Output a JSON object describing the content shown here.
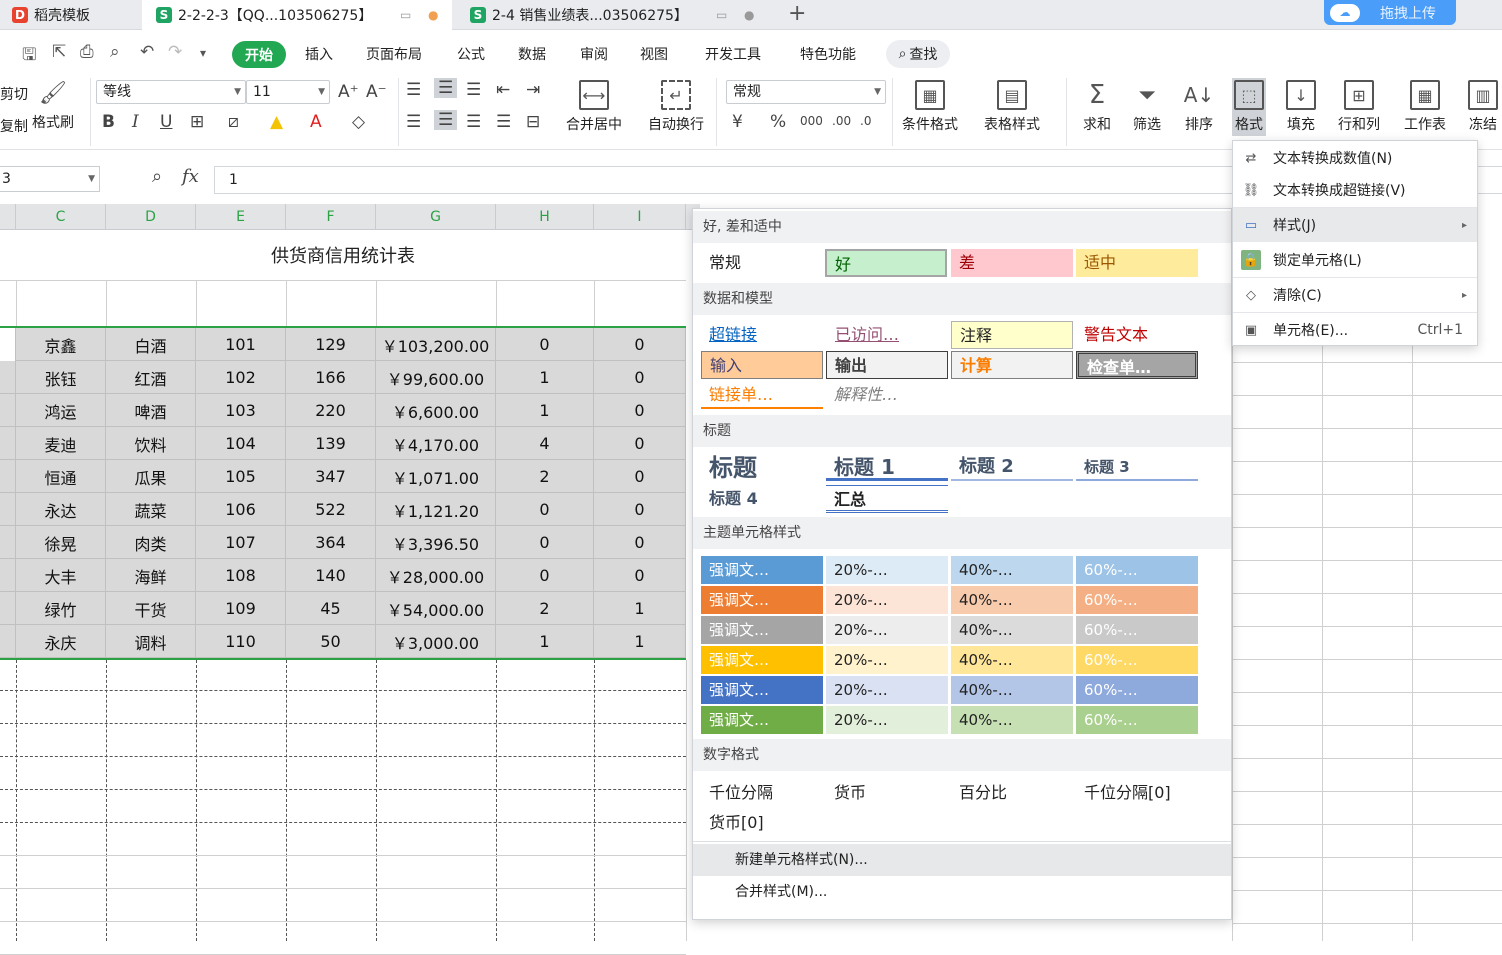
{
  "tabs": [
    {
      "label": "稻壳模板",
      "logo": "D"
    },
    {
      "label": "2-2-2-3【QQ...103506275】",
      "logo": "S"
    },
    {
      "label": "2-4 销售业绩表...03506275】",
      "logo": "S"
    }
  ],
  "upload_label": "拖拽上传",
  "menu": {
    "home": "开始",
    "items": [
      "插入",
      "页面布局",
      "公式",
      "数据",
      "审阅",
      "视图",
      "开发工具",
      "特色功能"
    ],
    "search": "查找"
  },
  "ribbon": {
    "cut": "剪切",
    "copy": "复制",
    "format_painter": "格式刷",
    "font_name": "等线",
    "font_size": "11",
    "number_format": "常规",
    "merge": "合并居中",
    "wrap": "自动换行",
    "cond_format": "条件格式",
    "table_style": "表格样式",
    "sum": "求和",
    "filter": "筛选",
    "sort": "排序",
    "format": "格式",
    "fill": "填充",
    "rowcol": "行和列",
    "sheet": "工作表",
    "freeze": "冻结"
  },
  "formula_bar": {
    "name_box": "3",
    "fx": "fx",
    "value": "1"
  },
  "columns": [
    "C",
    "D",
    "E",
    "F",
    "G",
    "H",
    "I"
  ],
  "sheet_title": "供货商信用统计表",
  "rows": [
    [
      "京鑫",
      "白酒",
      "101",
      "129",
      "￥103,200.00",
      "0",
      "0"
    ],
    [
      "张钰",
      "红酒",
      "102",
      "166",
      "￥99,600.00",
      "1",
      "0"
    ],
    [
      "鸿运",
      "啤酒",
      "103",
      "220",
      "￥6,600.00",
      "1",
      "0"
    ],
    [
      "麦迪",
      "饮料",
      "104",
      "139",
      "￥4,170.00",
      "4",
      "0"
    ],
    [
      "恒通",
      "瓜果",
      "105",
      "347",
      "￥1,071.00",
      "2",
      "0"
    ],
    [
      "永达",
      "蔬菜",
      "106",
      "522",
      "￥1,121.20",
      "0",
      "0"
    ],
    [
      "徐晃",
      "肉类",
      "107",
      "364",
      "￥3,396.50",
      "0",
      "0"
    ],
    [
      "大丰",
      "海鲜",
      "108",
      "140",
      "￥28,000.00",
      "0",
      "0"
    ],
    [
      "绿竹",
      "干货",
      "109",
      "45",
      "￥54,000.00",
      "2",
      "1"
    ],
    [
      "永庆",
      "调料",
      "110",
      "50",
      "￥3,000.00",
      "1",
      "1"
    ]
  ],
  "styles_panel": {
    "sec_good": "好, 差和适中",
    "good_items": [
      "常规",
      "好",
      "差",
      "适中"
    ],
    "sec_data": "数据和模型",
    "data_items": [
      "超链接",
      "已访问…",
      "注释",
      "警告文本",
      "输入",
      "输出",
      "计算",
      "检查单…",
      "链接单…",
      "解释性…"
    ],
    "sec_title": "标题",
    "title_items": [
      "标题",
      "标题 1",
      "标题 2",
      "标题 3",
      "标题 4",
      "汇总"
    ],
    "sec_theme": "主题单元格样式",
    "theme_labels": [
      "强调文…",
      "20%-…",
      "40%-…",
      "60%-…"
    ],
    "theme_colors": [
      [
        "#5b9bd5",
        "#ddebf7",
        "#bdd7ee",
        "#9dc3e6"
      ],
      [
        "#ed7d31",
        "#fce4d6",
        "#f8cbad",
        "#f4b084"
      ],
      [
        "#a5a5a5",
        "#ededed",
        "#dbdbdb",
        "#c9c9c9"
      ],
      [
        "#ffc000",
        "#fff2cc",
        "#ffe699",
        "#ffd966"
      ],
      [
        "#4472c4",
        "#d9e1f2",
        "#b4c6e7",
        "#8ea9db"
      ],
      [
        "#70ad47",
        "#e2efda",
        "#c6e0b4",
        "#a9d08e"
      ]
    ],
    "sec_number": "数字格式",
    "number_items": [
      "千位分隔",
      "货币",
      "百分比",
      "千位分隔[0]",
      "货币[0]"
    ],
    "new_style": "新建单元格样式(N)...",
    "merge_style": "合并样式(M)..."
  },
  "context_menu": [
    {
      "label": "文本转换成数值(N)",
      "icon": "text-to-number-icon"
    },
    {
      "label": "文本转换成超链接(V)",
      "icon": "text-to-link-icon"
    },
    {
      "label": "样式(J)",
      "icon": "style-icon",
      "sub": true
    },
    {
      "label": "锁定单元格(L)",
      "icon": "lock-cell-icon"
    },
    {
      "label": "清除(C)",
      "icon": "eraser-icon",
      "sub": true
    },
    {
      "label": "单元格(E)...",
      "icon": "cell-format-icon",
      "shortcut": "Ctrl+1"
    }
  ]
}
